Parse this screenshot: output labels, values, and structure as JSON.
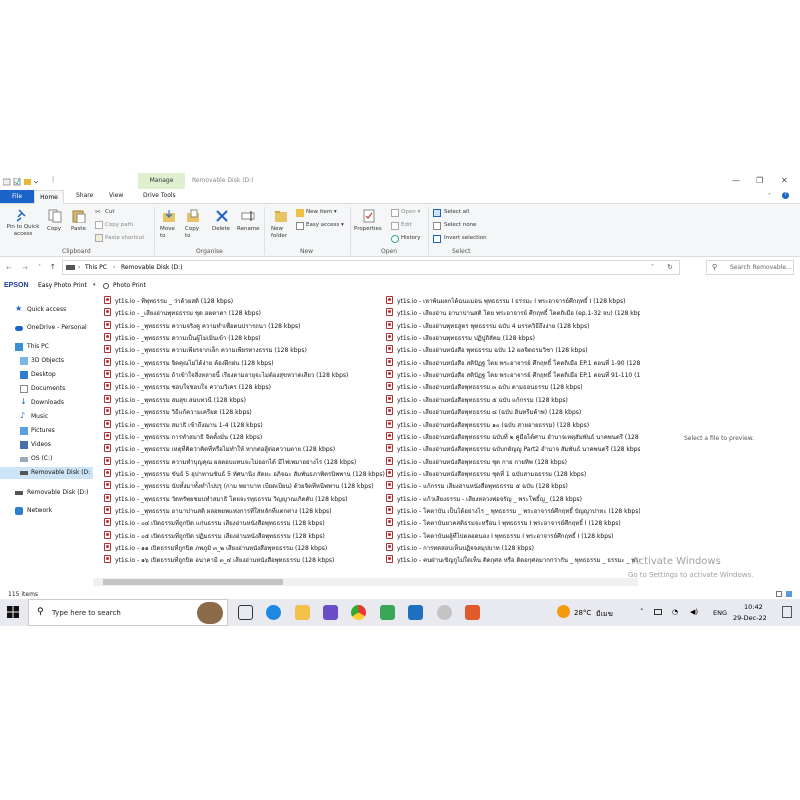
{
  "titlebar": {
    "manage_tab": "Manage",
    "window_title": "Removable Disk (D:)",
    "quick_access_suffix": "|"
  },
  "tabs": [
    "File",
    "Home",
    "Share",
    "View",
    "Drive Tools"
  ],
  "ribbon": {
    "clipboard": {
      "pin": "Pin to Quick access",
      "copy": "Copy",
      "paste": "Paste",
      "cut": "Cut",
      "copy_path": "Copy path",
      "paste_shortcut": "Paste shortcut",
      "group": "Clipboard"
    },
    "organise": {
      "move_to": "Move to",
      "copy_to": "Copy to",
      "delete": "Delete",
      "rename": "Rename",
      "group": "Organise"
    },
    "new": {
      "new_folder": "New folder",
      "new_item": "New item ▾",
      "easy_access": "Easy access ▾",
      "group": "New"
    },
    "open": {
      "properties": "Properties",
      "open": "Open ▾",
      "edit": "Edit",
      "history": "History",
      "group": "Open"
    },
    "select": {
      "select_all": "Select all",
      "select_none": "Select none",
      "invert": "Invert selection",
      "group": "Select"
    }
  },
  "address": {
    "this_pc": "This PC",
    "sep": "›",
    "drive": "Removable Disk (D:)",
    "search_placeholder": "Search Removable..."
  },
  "epson": {
    "brand": "EPSON",
    "easy_photo": "Easy Photo Print",
    "photo_print": "Photo Print"
  },
  "nav": [
    "Quick access",
    "OneDrive - Personal",
    "This PC",
    "3D Objects",
    "Desktop",
    "Documents",
    "Downloads",
    "Music",
    "Pictures",
    "Videos",
    "OS (C:)",
    "Removable Disk (D:",
    "Removable Disk (D:)",
    "Network"
  ],
  "files_col1": [
    "yt1s.io - ทีพุทธรรม _ ว่าด้วยสติ (128 kbps)",
    "yt1s.io - _เสียงอ่านพุทธธรรม ชุด อตตาตา (128 kbps)",
    "yt1s.io - _พุทธธรรม ความจริงคู ความทำเพื่อตนปรารถนา (128 kbps)",
    "yt1s.io - _พุทธธรรม ความเป็นผู้ไม่เมิ่นเข้า (128 kbps)",
    "yt1s.io - _พุทธธรรม ความเพียรจากเล็ก ความเพียรทางธรรม (128 kbps)",
    "yt1s.io - _พุทธธรรม จิตคุณไม่ได้ง่าย ต้องฝึกฝน (128 kbps)",
    "yt1s.io - _พุทธธรรม ถ้าเข้าใจสิ่งหลายนี้ เรียงตามอายุจะไม่ต้องสุขหวาดเสียว (128 kbps)",
    "yt1s.io - _พุทธธรรม ชอบใจชอบใจ ความวิเคร (128 kbps)",
    "yt1s.io - _พุทธธรรม สมสุข สมบทวนี (128 kbps)",
    "yt1s.io - _พุทธธรรม วิธีแก้ความเครียด (128 kbps)",
    "yt1s.io - _พุทธธรรม สมาธิ เข้าถึงฌาน 1-4 (128 kbps)",
    "yt1s.io - _พุทธธรรม การทำสมาธิ จิตตั้งมั่น (128 kbps)",
    "yt1s.io - _พุทธธรรม เหตุที่คิดว่าคิดที่หรือไม่ทำให้ หากต่อสู้ต่อความตาย (128 kbps)",
    "yt1s.io - _พุทธธรรม ความทำบุญคุณ ผลตอบแทนจะไม่ออกได้ มีไฟเพมาอย่างไร (128 kbps)",
    "yt1s.io - _พุทธธรรม ขันธ์ 5 อุปาทานขันธ์ 5 ทัศนานิง สัตยะ อภิจฉะ สัมพันธภาพิตรนิพพาน (128 kbps)",
    "yt1s.io - _พุทธธรรม นับทั้งมาทั้งทำไปปรุ (กาม พยาบาท เบียดเบียน) ด้วยจิตที่หนีพพาน (128 kbps)",
    "yt1s.io - _พุทธธรรม วัดทรัพยชมบทำสมาธิ โดยจะรทุธธรรม วิญญาณเกิดดับ (128 kbps)",
    "yt1s.io - _พุทธธรรม อานาปานสติ ผลอพยพแห่งการที่ใส่หลักที่แตกต่าง (128 kbps)",
    "yt1s.io - ๐๔ เปิดธรรมที่ถูกปิด แก่นธรรม เสียงอ่านหนังสือพุทธธรรม (128 kbps)",
    "yt1s.io - ๐๕ เปิดธรรมที่ถูกปิด ปฏิมธรรม เสียงอ่านหนังสือพุทธธรรม (128 kbps)",
    "yt1s.io - ๑๑ เปิดธรรมที่ถูกปิด ภพภูมิ ๓_๒ เสียงอ่านหนังสือพุทธธรรม (128 kbps)",
    "yt1s.io - ๑๖ เปิดธรรมที่ถูกปิด อนาคามี ๓_๔ เสียงอ่านหนังสือพุทธธรรม (128 kbps)"
  ],
  "files_col2": [
    "yt1s.io - เหาพ้นผลกได้ฉนแมอน พุทธธรรม I ธรรมะ I พระอาจารย์ศึกฤทธิ์ I (128 kbps)",
    "yt1s.io - เสียงอ่าน อานาปานสติ โดย พระอาจารย์ ศึกฤทธิ์ โคตถิเมือ (ep.1-32 จบ) (128 kbps)",
    "yt1s.io - เสียงอ่านพุทธสูตร พุทธธรรม ฉบับ 4 มรรควิธีถึงง่าย (128 kbps)",
    "yt1s.io - เสียงอ่านพุทธธรรม ปฏิปูถิสัคม (128 kbps)",
    "yt1s.io - เสียงอ่านหนังสือ พุทธธรรม ฉบับ 12 ผลจิตธรมวิชา (128 kbps)",
    "yt1s.io - เสียงอ่านหนังสือ สติปัฏฐ โดย พระอาจารย์ ศึกฤทธิ์ โคตถิเมือ EP.1 ตอนที่ 1-90 (128 kbps)",
    "yt1s.io - เสียงอ่านหนังสือ สติปัฏฐ โดย พระอาจารย์ ศึกฤทธิ์ โคตถิเมือ EP.1 ตอนที่ 91-110 (128 kbps)",
    "yt1s.io - เสียงอ่านหนังสือพุทธธรรม ๓ ฉบับ ตามธอนธรรม (128 kbps)",
    "yt1s.io - เสียงอ่านหนังสือพุทธธรรม ๕ ฉบับ แก้กรรม (128 kbps)",
    "yt1s.io - เสียงอ่านหนังสือพุทธธรรม ๘ (ฉบับ อินทรีมค้าพ) (128 kbps)",
    "yt1s.io - เสียงอ่านหนังสือพุทธธรรม ๑๐ (ฉบับ สายอายธรรม) (128 kbps)",
    "yt1s.io - เสียงอ่านหนังสือพุทธธรรม ฉบับที่ ๒ คู่มือได้ศาน อำนาจเหตุสัมพันธ์ นาคพนตรี (128 kbps)",
    "yt1s.io - เสียงอ่านหนังสือพุทธธรรม ฉบับกตัญญู Part2 อำนาจ สัมพันธ์ นาคพนตรี (128 kbps)",
    "yt1s.io - เสียงอ่านหนังสือพุทธธรรม ชุด กาย กายทิพ (128 kbps)",
    "yt1s.io - เสียงอ่านหนังสือพุทธธรรม ชุดที่ 1 ฉบับสามอธรรม (128 kbps)",
    "yt1s.io - แก้กรรม เสียงอ่านหนังสือพุทธธรรม ๕ ฉบับ (128 kbps)",
    "yt1s.io - แก้วเสียงธรรม - เสียงหลวงพ่อจรัญ _ พระโพธิ์ญ_ (128 kbps)",
    "yt1s.io - โคตาบัน เป็นได้อย่างไร _ พุทธธรรม _ พระอาจารย์ศึกฤทธิ์ ปัญญาปาหะ (128 kbps)",
    "yt1s.io - โคตาบันยาคสติธรมจะหรือน I พุทธธรรม I พระอาจารย์ศึกฤทธิ์ I (128 kbps)",
    "yt1s.io - โคตาบันผลู้ที่ไปตลอดนอง I พุทธธรรม I พระอาจารย์ศึกฤทธิ์ I (128 kbps)",
    "yt1s.io - การทดสอบเห็นปฏิจจสมุปบาท (128 kbps)",
    "yt1s.io - คนฝ่านเขิญกูไม่ใดเห็น ติดกุศล หรือ ติดอกุศลมากกว่ากัน _ พุทธธรรม _ ธรรมะ _ พระอาจารย์ (128 kbps)"
  ],
  "preview_text": "Select a file to preview.",
  "watermark": {
    "line1": "Activate Windows",
    "line2": "Go to Settings to activate Windows."
  },
  "status": "115 items",
  "taskbar": {
    "search": "Type here to search",
    "temp": "28°C",
    "weather": "มีเมฆ",
    "lang": "ENG",
    "time": "10:42",
    "date": "29-Dec-22"
  },
  "colors": {
    "accent": "#1a64c8",
    "manage": "#dff0d0",
    "selected": "#cce4f7"
  }
}
